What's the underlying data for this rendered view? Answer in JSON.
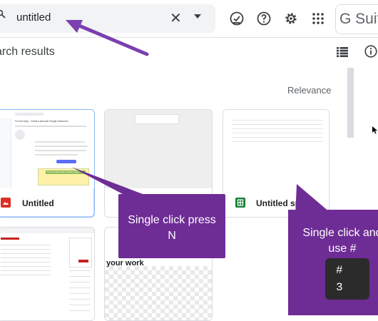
{
  "search": {
    "query": "untitled"
  },
  "header": {
    "brand": "G Suit"
  },
  "results": {
    "title": "arch results",
    "sort_label": "Relevance"
  },
  "cards": [
    {
      "title": "Untitled",
      "type": "slides"
    },
    {
      "title": "",
      "type": "blank"
    },
    {
      "title": "Untitled sprea",
      "type": "sheets"
    },
    {
      "title": "",
      "type": "document"
    },
    {
      "title": "your work",
      "type": "document"
    }
  ],
  "thumb1": {
    "header": "For and Easy - Create a personal Google Classroom",
    "cell": "You can create a link a specific Google"
  },
  "annotations": {
    "callout1": "Single click press N",
    "callout2": "Single click and use #",
    "key_top": "#",
    "key_bottom": "3"
  },
  "colors": {
    "accent": "#6e2c95",
    "arrow": "#7b3fb0",
    "slides": "#d93025",
    "sheets": "#188038",
    "selected_border": "#8ab4f8"
  }
}
